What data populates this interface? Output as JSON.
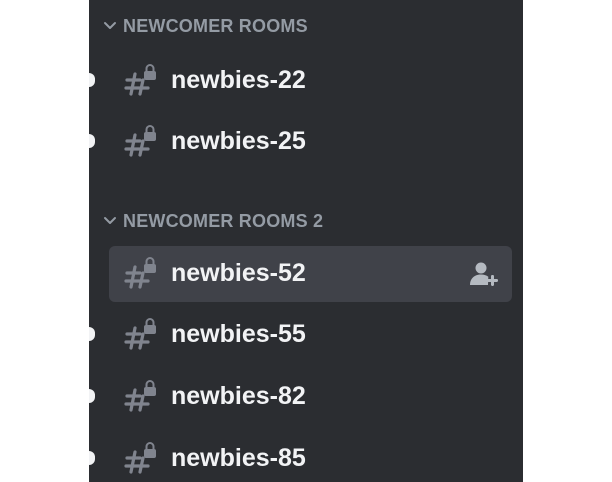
{
  "colors": {
    "sidebar_bg": "#2b2d31",
    "selected_row_bg": "#404249",
    "category_text": "#949ba4",
    "channel_text": "#f2f3f5",
    "icon": "#80848e"
  },
  "categories": [
    {
      "label": "NEWCOMER ROOMS",
      "icon": "chevron-down-icon",
      "channels": [
        {
          "name": "newbies-22",
          "icon": "locked-hash-icon",
          "unread": true,
          "selected": false
        },
        {
          "name": "newbies-25",
          "icon": "locked-hash-icon",
          "unread": true,
          "selected": false
        }
      ]
    },
    {
      "label": "NEWCOMER ROOMS 2",
      "icon": "chevron-down-icon",
      "channels": [
        {
          "name": "newbies-52",
          "icon": "locked-hash-icon",
          "unread": false,
          "selected": true,
          "action_icon": "invite-members-icon"
        },
        {
          "name": "newbies-55",
          "icon": "locked-hash-icon",
          "unread": true,
          "selected": false
        },
        {
          "name": "newbies-82",
          "icon": "locked-hash-icon",
          "unread": true,
          "selected": false
        },
        {
          "name": "newbies-85",
          "icon": "locked-hash-icon",
          "unread": true,
          "selected": false
        }
      ]
    }
  ]
}
